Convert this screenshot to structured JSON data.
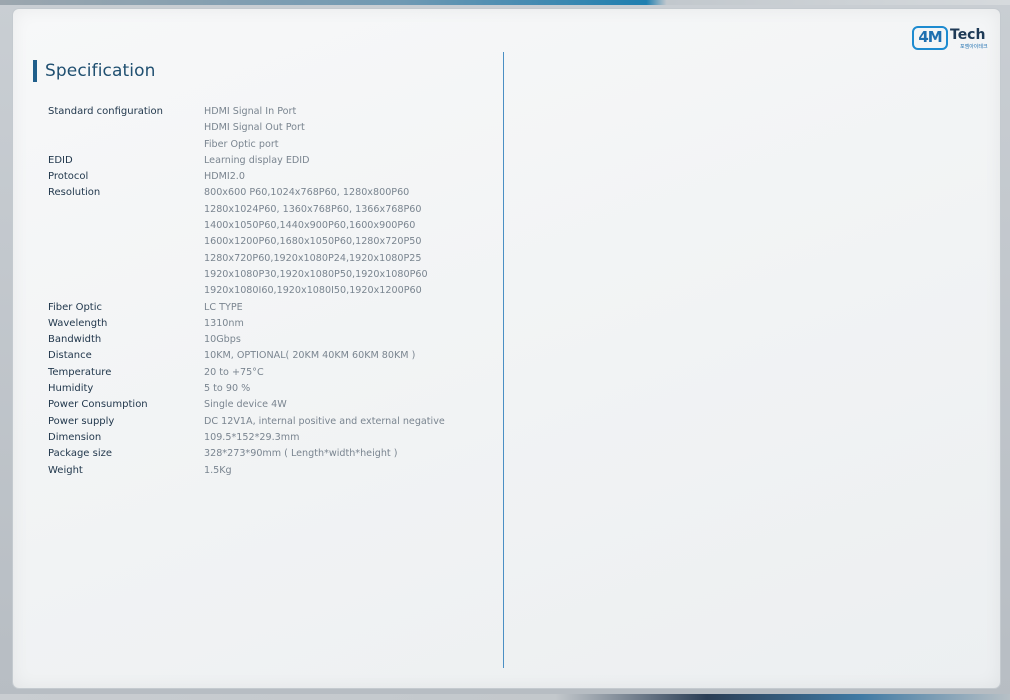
{
  "logo": {
    "mark": "4M",
    "name": "Tech",
    "sub": "포엠아이테크"
  },
  "section_title": "Specification",
  "specs": [
    {
      "label": "Standard configuration",
      "values": [
        "HDMI Signal In Port",
        "HDMI Signal Out Port",
        "Fiber Optic port"
      ]
    },
    {
      "label": "EDID",
      "values": [
        "Learning display EDID"
      ]
    },
    {
      "label": "Protocol",
      "values": [
        "HDMI2.0"
      ]
    },
    {
      "label": "Resolution",
      "values": [
        "800x600 P60,1024x768P60, 1280x800P60",
        "1280x1024P60, 1360x768P60, 1366x768P60",
        "1400x1050P60,1440x900P60,1600x900P60",
        "1600x1200P60,1680x1050P60,1280x720P50",
        "1280x720P60,1920x1080P24,1920x1080P25",
        "1920x1080P30,1920x1080P50,1920x1080P60",
        "1920x1080I60,1920x1080I50,1920x1200P60"
      ]
    },
    {
      "label": "Fiber Optic",
      "values": [
        "LC TYPE"
      ]
    },
    {
      "label": "Wavelength",
      "values": [
        "1310nm"
      ]
    },
    {
      "label": "Bandwidth",
      "values": [
        "10Gbps"
      ]
    },
    {
      "label": "Distance",
      "values": [
        "10KM, OPTIONAL( 20KM 40KM 60KM 80KM )"
      ]
    },
    {
      "label": "Temperature",
      "values": [
        "20 to +75°C"
      ]
    },
    {
      "label": "Humidity",
      "values": [
        "5 to 90 %"
      ]
    },
    {
      "label": "Power Consumption",
      "values": [
        "Single device 4W"
      ]
    },
    {
      "label": "Power supply",
      "values": [
        "DC 12V1A, internal positive and external negative"
      ]
    },
    {
      "label": "Dimension",
      "values": [
        "109.5*152*29.3mm"
      ]
    },
    {
      "label": "Package size",
      "values": [
        " 328*273*90mm ( Length*width*height )"
      ]
    },
    {
      "label": "Weight",
      "values": [
        "1.5Kg"
      ]
    }
  ]
}
